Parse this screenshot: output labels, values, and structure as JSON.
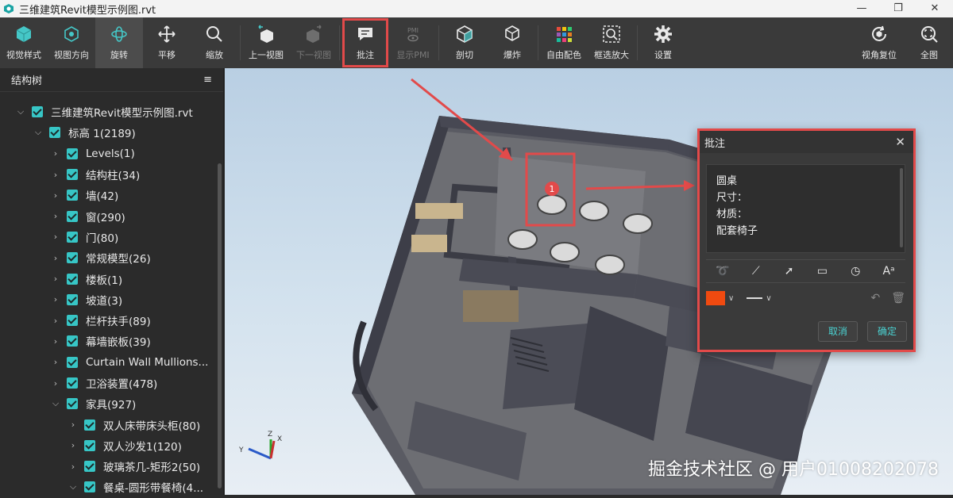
{
  "window": {
    "title": "三维建筑Revit模型示例图.rvt",
    "controls": [
      "—",
      "❐",
      "✕"
    ]
  },
  "toolbar": {
    "items": [
      {
        "label": "视觉样式"
      },
      {
        "label": "视图方向"
      },
      {
        "label": "旋转"
      },
      {
        "label": "平移"
      },
      {
        "label": "缩放"
      },
      {
        "label": "上一视图"
      },
      {
        "label": "下一视图"
      },
      {
        "label": "批注"
      },
      {
        "label": "显示PMI"
      },
      {
        "label": "剖切"
      },
      {
        "label": "爆炸"
      },
      {
        "label": "自由配色"
      },
      {
        "label": "框选放大"
      },
      {
        "label": "设置"
      },
      {
        "label": "视角复位"
      },
      {
        "label": "全图"
      }
    ],
    "pmi_icon_text": "PMI"
  },
  "sidebar": {
    "title": "结构树",
    "menu_icon": "≡",
    "tree": [
      {
        "label": "三维建筑Revit模型示例图.rvt",
        "expanded": true
      },
      {
        "label": "标高 1(2189)",
        "expanded": true
      },
      {
        "label": "Levels(1)"
      },
      {
        "label": "结构柱(34)"
      },
      {
        "label": "墙(42)"
      },
      {
        "label": "窗(290)"
      },
      {
        "label": "门(80)"
      },
      {
        "label": "常规模型(26)"
      },
      {
        "label": "楼板(1)"
      },
      {
        "label": "坡道(3)"
      },
      {
        "label": "栏杆扶手(89)"
      },
      {
        "label": "幕墙嵌板(39)"
      },
      {
        "label": "Curtain Wall Mullions..."
      },
      {
        "label": "卫浴装置(478)"
      },
      {
        "label": "家具(927)",
        "expanded": true
      },
      {
        "label": "双人床带床头柜(80)"
      },
      {
        "label": "双人沙发1(120)"
      },
      {
        "label": "玻璃茶几-矩形2(50)"
      },
      {
        "label": "餐桌-圆形带餐椅(4..."
      }
    ]
  },
  "viewport": {
    "marker_number": "1",
    "axes": {
      "x": "X",
      "y": "Y",
      "z": "Z"
    },
    "watermark": "掘金技术社区 @ 用户01008202078"
  },
  "annotation_dialog": {
    "title": "批注",
    "text_lines": [
      "圆桌",
      "尺寸：",
      "材质：",
      "配套椅子"
    ],
    "tools": [
      "freehand-icon",
      "line-icon",
      "arrow-icon",
      "rectangle-icon",
      "circle-icon",
      "text-icon"
    ],
    "text_tool_label": "Aᵃ",
    "color": "#f04a10",
    "cancel_label": "取消",
    "confirm_label": "确定"
  },
  "colors": {
    "accent": "#37c6c6",
    "highlight": "#e24a4a",
    "toolbar_bg": "#3a3a3a"
  }
}
